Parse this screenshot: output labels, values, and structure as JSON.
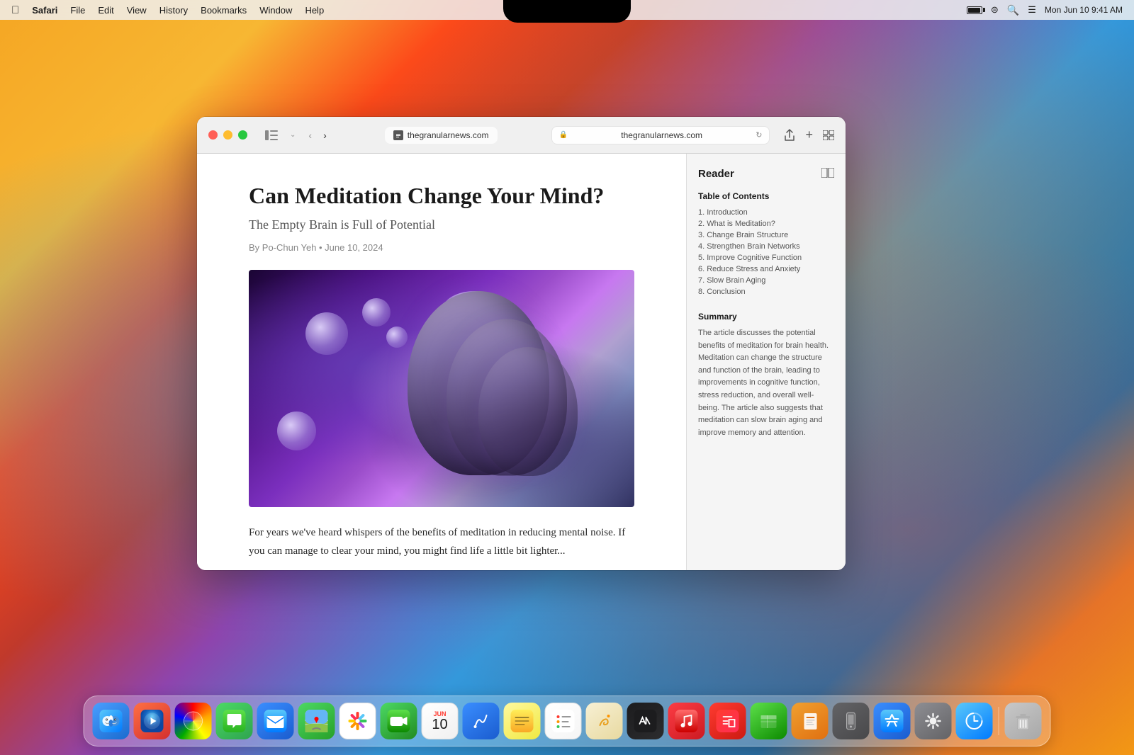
{
  "desktop": {
    "background": "macOS gradient"
  },
  "menubar": {
    "app_name": "Safari",
    "menus": [
      "File",
      "Edit",
      "View",
      "History",
      "Bookmarks",
      "Window",
      "Help"
    ],
    "clock": "Mon Jun 10  9:41 AM"
  },
  "safari": {
    "address": "thegranularnews.com",
    "tab_title": "thegranularnews.com"
  },
  "article": {
    "title": "Can Meditation Change Your Mind?",
    "subtitle": "The Empty Brain is Full of Potential",
    "byline": "By Po-Chun Yeh  •  June 10, 2024",
    "body_text": "For years we've heard whispers of the benefits of meditation in reducing mental noise. If you can manage to clear your mind, you might find life a little bit lighter..."
  },
  "reader": {
    "title": "Reader",
    "toc_heading": "Table of Contents",
    "toc_items": [
      "1. Introduction",
      "2. What is Meditation?",
      "3. Change Brain Structure",
      "4. Strengthen Brain Networks",
      "5. Improve Cognitive Function",
      "6. Reduce Stress and Anxiety",
      "7. Slow Brain Aging",
      "8. Conclusion"
    ],
    "summary_heading": "Summary",
    "summary_text": "The article discusses the potential benefits of meditation for brain health. Meditation can change the structure and function of the brain, leading to improvements in cognitive function, stress reduction, and overall well-being. The article also suggests that meditation can slow brain aging and improve memory and attention."
  },
  "dock": {
    "icons": [
      {
        "name": "Finder",
        "class": "dock-finder",
        "emoji": "🔵"
      },
      {
        "name": "Launchpad",
        "class": "dock-launchpad",
        "emoji": "🚀"
      },
      {
        "name": "Safari",
        "class": "dock-safari",
        "emoji": "🧭"
      },
      {
        "name": "Messages",
        "class": "dock-messages",
        "emoji": "💬"
      },
      {
        "name": "Mail",
        "class": "dock-mail",
        "emoji": "✉️"
      },
      {
        "name": "Maps",
        "class": "dock-maps",
        "emoji": "🗺"
      },
      {
        "name": "Photos",
        "class": "dock-photos",
        "emoji": "🖼"
      },
      {
        "name": "FaceTime",
        "class": "dock-facetime",
        "emoji": "📹"
      },
      {
        "name": "Calendar",
        "class": "dock-calendar",
        "special": "calendar"
      },
      {
        "name": "Freeform",
        "class": "dock-freeform2",
        "emoji": "✏️"
      },
      {
        "name": "Notes",
        "class": "dock-notes",
        "emoji": "📝"
      },
      {
        "name": "Reminders",
        "class": "dock-reminders",
        "emoji": "✅"
      },
      {
        "name": "Freeform Canvas",
        "class": "dock-freeform",
        "emoji": "🎨"
      },
      {
        "name": "Apple TV",
        "class": "dock-appletv",
        "emoji": "📺"
      },
      {
        "name": "Music",
        "class": "dock-music",
        "emoji": "🎵"
      },
      {
        "name": "News",
        "class": "dock-news",
        "emoji": "📰"
      },
      {
        "name": "Numbers",
        "class": "dock-numbers",
        "emoji": "📊"
      },
      {
        "name": "Pages",
        "class": "dock-pages",
        "emoji": "📄"
      },
      {
        "name": "iPhone Mirroring",
        "class": "dock-iphone",
        "emoji": "📱"
      },
      {
        "name": "App Store",
        "class": "dock-appstore",
        "emoji": "🅰"
      },
      {
        "name": "System Settings",
        "class": "dock-settings",
        "emoji": "⚙️"
      },
      {
        "name": "Screen Time",
        "class": "dock-screentime",
        "emoji": "⏱"
      },
      {
        "name": "Trash",
        "class": "dock-trash",
        "emoji": "🗑"
      }
    ],
    "calendar_month": "JUN",
    "calendar_day": "10"
  }
}
